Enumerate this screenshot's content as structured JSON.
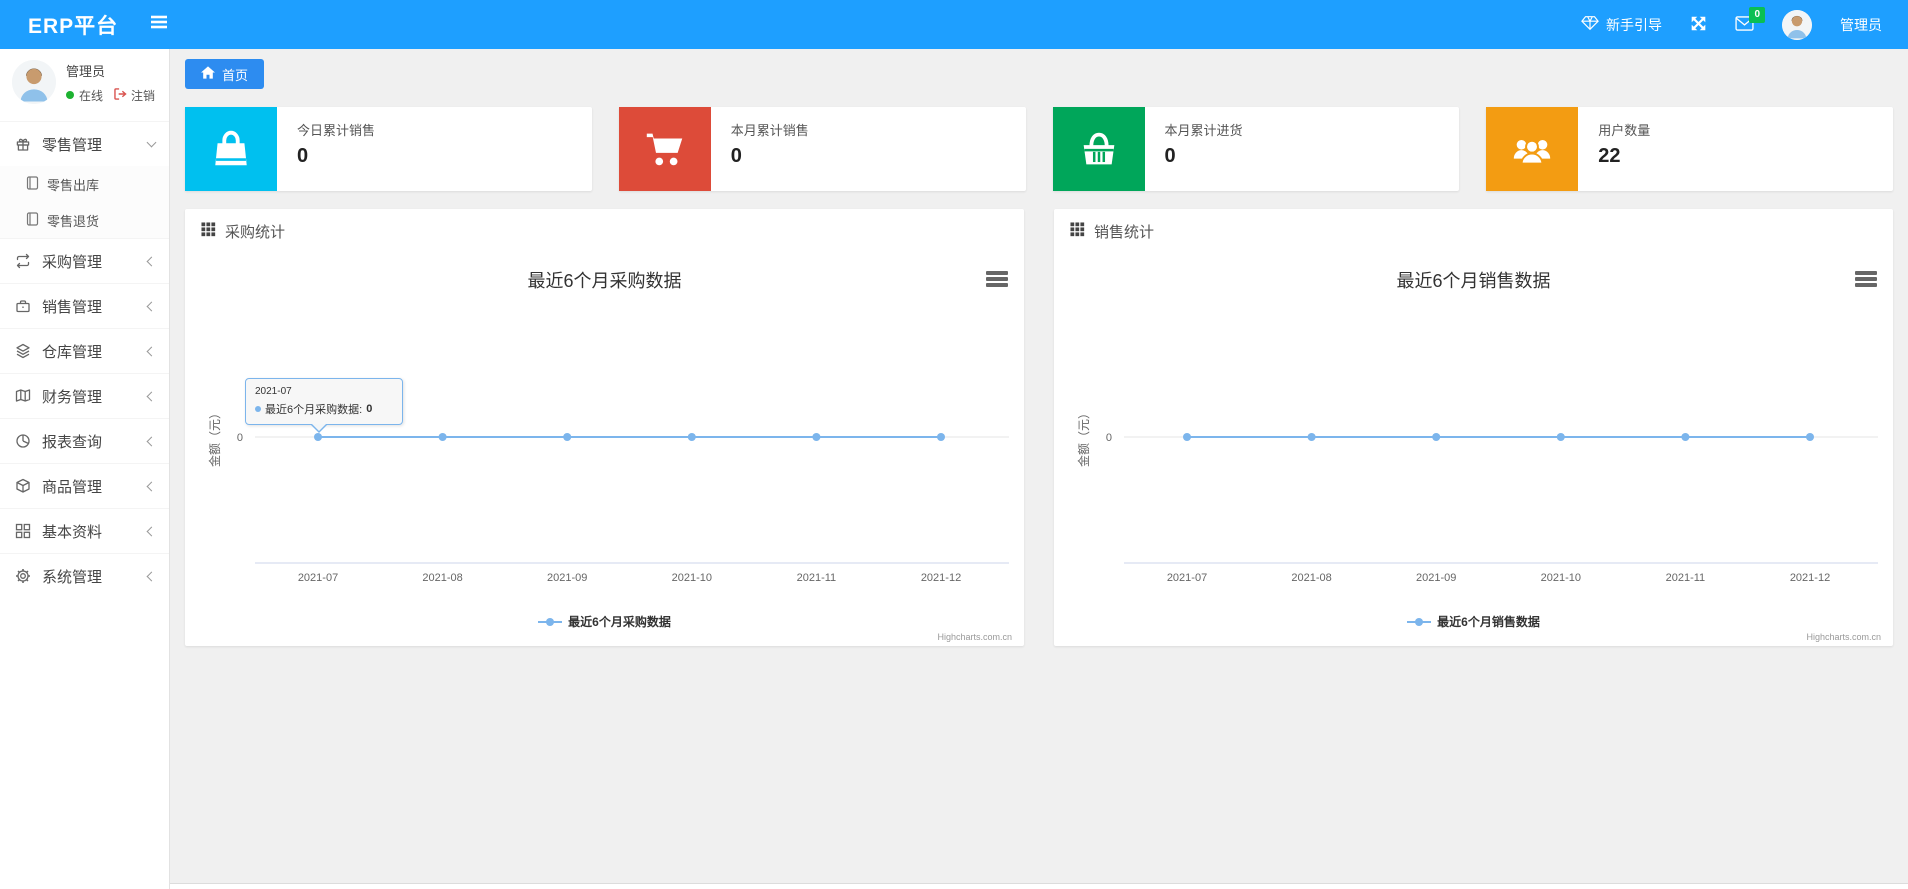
{
  "navbar": {
    "brand": "ERP平台",
    "guide_label": "新手引导",
    "mail_badge": "0",
    "username": "管理员"
  },
  "sidebar": {
    "user": {
      "name": "管理员",
      "status": "在线",
      "logout": "注销"
    },
    "menu": [
      {
        "label": "零售管理",
        "icon": "gift-icon",
        "state": "expanded",
        "children": [
          {
            "label": "零售出库",
            "icon": "file-icon"
          },
          {
            "label": "零售退货",
            "icon": "file-icon"
          }
        ]
      },
      {
        "label": "采购管理",
        "icon": "exchange-icon"
      },
      {
        "label": "销售管理",
        "icon": "briefcase-icon"
      },
      {
        "label": "仓库管理",
        "icon": "layers-icon"
      },
      {
        "label": "财务管理",
        "icon": "book-icon"
      },
      {
        "label": "报表查询",
        "icon": "pie-chart-icon"
      },
      {
        "label": "商品管理",
        "icon": "box-icon"
      },
      {
        "label": "基本资料",
        "icon": "grid-icon"
      },
      {
        "label": "系统管理",
        "icon": "gear-icon"
      }
    ]
  },
  "tabs": [
    {
      "label": "首页",
      "active": true
    }
  ],
  "stat_cards": [
    {
      "title": "今日累计销售",
      "value": "0",
      "color": "#00c0ef",
      "icon": "shopping-bag-icon"
    },
    {
      "title": "本月累计销售",
      "value": "0",
      "color": "#dd4b39",
      "icon": "shopping-cart-icon"
    },
    {
      "title": "本月累计进货",
      "value": "0",
      "color": "#00a65a",
      "icon": "shopping-basket-icon"
    },
    {
      "title": "用户数量",
      "value": "22",
      "color": "#f39c12",
      "icon": "users-icon"
    }
  ],
  "panels": [
    {
      "title": "采购统计"
    },
    {
      "title": "销售统计"
    }
  ],
  "chart_data": [
    {
      "type": "line",
      "title": "最近6个月采购数据",
      "categories": [
        "2021-07",
        "2021-08",
        "2021-09",
        "2021-10",
        "2021-11",
        "2021-12"
      ],
      "series": [
        {
          "name": "最近6个月采购数据",
          "values": [
            0,
            0,
            0,
            0,
            0,
            0
          ],
          "color": "#7cb5ec"
        }
      ],
      "xlabel": "",
      "ylabel": "金额（元）",
      "ylim": [
        -1,
        1
      ],
      "yticks": [
        0
      ],
      "grid": true,
      "legend_position": "bottom",
      "credits": "Highcharts.com.cn",
      "tooltip": {
        "category": "2021-07",
        "series_label": "最近6个月采购数据:",
        "value": "0"
      }
    },
    {
      "type": "line",
      "title": "最近6个月销售数据",
      "categories": [
        "2021-07",
        "2021-08",
        "2021-09",
        "2021-10",
        "2021-11",
        "2021-12"
      ],
      "series": [
        {
          "name": "最近6个月销售数据",
          "values": [
            0,
            0,
            0,
            0,
            0,
            0
          ],
          "color": "#7cb5ec"
        }
      ],
      "xlabel": "",
      "ylabel": "金额（元）",
      "ylim": [
        -1,
        1
      ],
      "yticks": [
        0
      ],
      "grid": true,
      "legend_position": "bottom",
      "credits": "Highcharts.com.cn"
    }
  ],
  "colors": {
    "navbar": "#1e9fff",
    "tab": "#2d8cf0",
    "badge": "#0abf53",
    "series": "#7cb5ec"
  }
}
